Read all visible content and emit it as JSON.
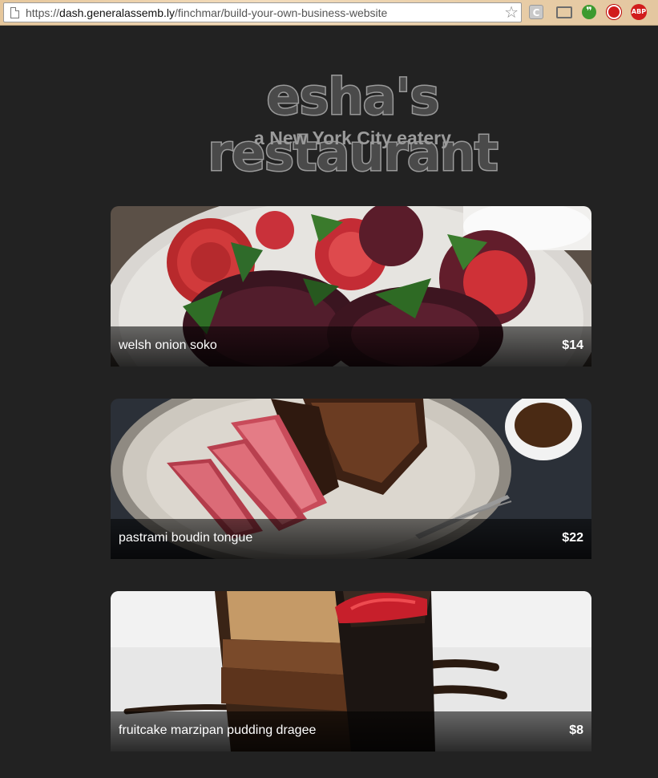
{
  "browser": {
    "url_scheme": "https://",
    "url_host": "dash.generalassemb.ly",
    "url_path": "/finchmar/build-your-own-business-website",
    "icons": [
      "page-icon",
      "bookmark-star-icon",
      "extension-c-icon",
      "cast-icon",
      "evernote-icon",
      "shield-extension-icon",
      "adblock-plus-icon"
    ],
    "ext_c_label": "C",
    "ext_abp_label": "ABP"
  },
  "header": {
    "title": "esha's restaurant",
    "tagline": "a New York City eatery"
  },
  "menu": {
    "items": [
      {
        "name": "welsh onion soko",
        "price": "$14",
        "photo": "beet salad"
      },
      {
        "name": "pastrami boudin tongue",
        "price": "$22",
        "photo": "sliced steak"
      },
      {
        "name": "fruitcake marzipan pudding dragee",
        "price": "$8",
        "photo": "chocolate cake"
      }
    ]
  }
}
